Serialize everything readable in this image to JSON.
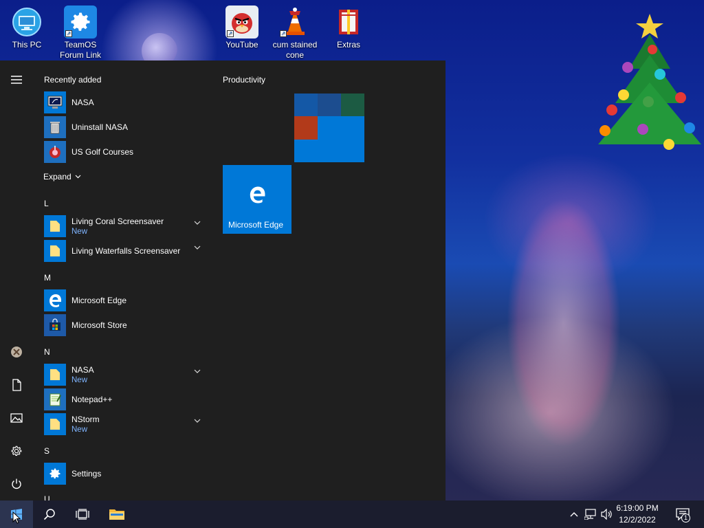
{
  "desktop": {
    "icons": [
      {
        "label": "This PC"
      },
      {
        "label": "TeamOS Forum Link"
      },
      {
        "label": "YouTube"
      },
      {
        "label": "cum stained cone"
      },
      {
        "label": "Extras"
      }
    ]
  },
  "start_menu": {
    "recently_added_title": "Recently added",
    "recent": [
      {
        "label": "NASA"
      },
      {
        "label": "Uninstall NASA"
      },
      {
        "label": "US Golf Courses"
      }
    ],
    "expand_label": "Expand",
    "groups": [
      {
        "letter": "L",
        "apps": [
          {
            "label": "Living Coral Screensaver",
            "sub": "New"
          },
          {
            "label": "Living Waterfalls Screensaver",
            "sub": ""
          }
        ]
      },
      {
        "letter": "M",
        "apps": [
          {
            "label": "Microsoft Edge",
            "sub": ""
          },
          {
            "label": "Microsoft Store",
            "sub": ""
          }
        ]
      },
      {
        "letter": "N",
        "apps": [
          {
            "label": "NASA",
            "sub": "New"
          },
          {
            "label": "Notepad++",
            "sub": ""
          },
          {
            "label": "NStorm",
            "sub": "New"
          }
        ]
      },
      {
        "letter": "S",
        "apps": [
          {
            "label": "Settings",
            "sub": ""
          }
        ]
      },
      {
        "letter": "U"
      }
    ],
    "tiles": {
      "group_title": "Productivity",
      "edge_tile_label": "Microsoft Edge"
    }
  },
  "taskbar": {
    "time": "6:19:00 PM",
    "date": "12/2/2022",
    "notification_count": "1"
  },
  "colors": {
    "accent": "#0078d7",
    "start_bg": "#1f1f1f",
    "taskbar_bg": "#1b1d2e",
    "new_label": "#7fb4ff"
  }
}
